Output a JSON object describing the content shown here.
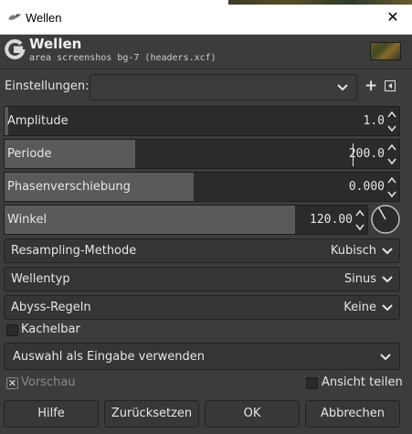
{
  "window": {
    "title": "Wellen",
    "close_glyph": "✕",
    "app_icon": "gimp-wilber-icon"
  },
  "header": {
    "title": "Wellen",
    "subtitle": "area screenshos bg-7 (headers.xcf)",
    "logo_icon": "gimp-g-icon",
    "thumbnail_icon": "image-thumbnail"
  },
  "presets": {
    "label": "Einstellungen:",
    "value": "",
    "add_icon": "plus-icon",
    "menu_icon": "menu-icon"
  },
  "params": [
    {
      "label": "Amplitude",
      "value": "1.0",
      "fraction": 0.01
    },
    {
      "label": "Periode",
      "value": "200.0",
      "fraction": 0.33
    },
    {
      "label": "Phasenverschiebung",
      "value": "0.000",
      "fraction": 0.48
    },
    {
      "label": "Winkel",
      "value": "120.00",
      "fraction": 0.8
    }
  ],
  "combos": [
    {
      "label": "Resampling-Methode",
      "value": "Kubisch"
    },
    {
      "label": "Wellentyp",
      "value": "Sinus"
    },
    {
      "label": "Abyss-Regeln",
      "value": "Keine"
    }
  ],
  "tile": {
    "label": "Kachelbar",
    "checked": false
  },
  "selection_input": {
    "label": "Auswahl als Eingabe verwenden"
  },
  "preview": {
    "label": "Vorschau",
    "checked": true,
    "check_glyph": "✕"
  },
  "split_view": {
    "label": "Ansicht teilen",
    "checked": false
  },
  "buttons": {
    "help": "Hilfe",
    "reset": "Zurücksetzen",
    "ok": "OK",
    "cancel": "Abbrechen"
  },
  "colors": {
    "bg": "#3c3c3c",
    "field": "#2b2b2b",
    "fill": "#5a5a5a",
    "text": "#e6e6e6"
  }
}
